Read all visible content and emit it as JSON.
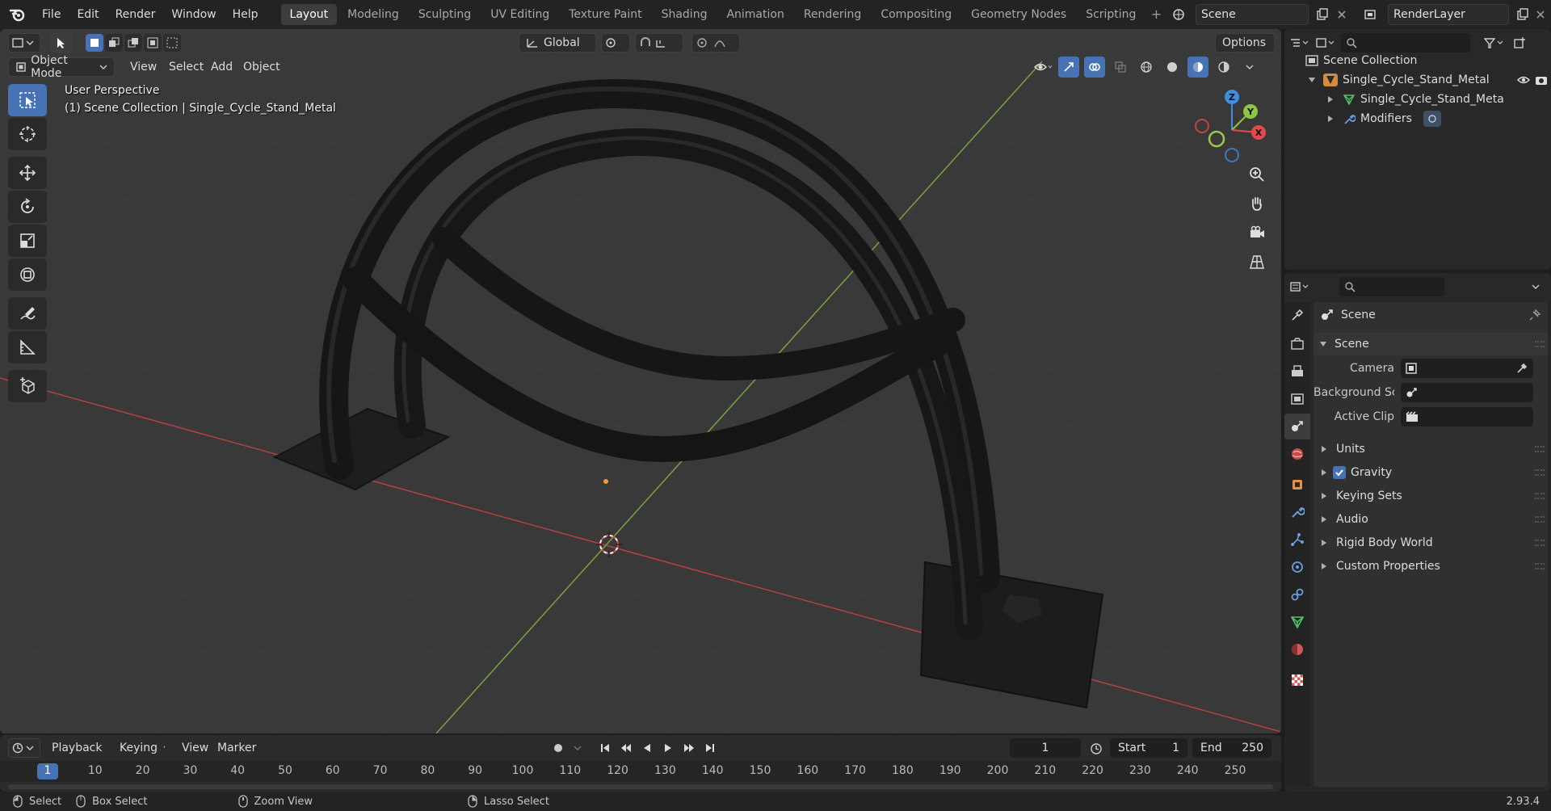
{
  "topbar": {
    "menus": [
      "File",
      "Edit",
      "Render",
      "Window",
      "Help"
    ],
    "workspaces": [
      "Layout",
      "Modeling",
      "Sculpting",
      "UV Editing",
      "Texture Paint",
      "Shading",
      "Animation",
      "Rendering",
      "Compositing",
      "Geometry Nodes",
      "Scripting"
    ],
    "active_workspace": "Layout",
    "scene": "Scene",
    "view_layer": "RenderLayer"
  },
  "viewport": {
    "transform_orientation": "Global",
    "options_label": "Options",
    "mode": "Object Mode",
    "menus": [
      "View",
      "Select",
      "Add",
      "Object"
    ],
    "overlay_line1": "User Perspective",
    "overlay_line2": "(1) Scene Collection | Single_Cycle_Stand_Metal",
    "gizmo": {
      "x": "X",
      "y": "Y",
      "z": "Z"
    }
  },
  "outliner": {
    "root": "Scene Collection",
    "object": "Single_Cycle_Stand_Metal",
    "mesh": "Single_Cycle_Stand_Meta",
    "modifiers": "Modifiers"
  },
  "properties": {
    "context": "Scene",
    "panel_title": "Scene",
    "camera_label": "Camera",
    "background_label": "Background Sce...",
    "active_clip_label": "Active Clip",
    "sections": [
      "Units",
      "Gravity",
      "Keying Sets",
      "Audio",
      "Rigid Body World",
      "Custom Properties"
    ],
    "gravity_checked": true
  },
  "timeline": {
    "menus": [
      "Playback",
      "Keying",
      "View",
      "Marker"
    ],
    "current_frame": "1",
    "start_label": "Start",
    "start": "1",
    "end_label": "End",
    "end": "250",
    "ruler": [
      "1",
      "10",
      "20",
      "30",
      "40",
      "50",
      "60",
      "70",
      "80",
      "90",
      "100",
      "110",
      "120",
      "130",
      "140",
      "150",
      "160",
      "170",
      "180",
      "190",
      "200",
      "210",
      "220",
      "230",
      "240",
      "250"
    ]
  },
  "status": {
    "select": "Select",
    "box_select": "Box Select",
    "zoom_view": "Zoom View",
    "lasso_select": "Lasso Select",
    "version": "2.93.4"
  },
  "colors": {
    "accent": "#4772b3",
    "x_axis": "#e04a4a",
    "y_axis": "#8dc63f",
    "z_axis": "#3d8ee0"
  }
}
